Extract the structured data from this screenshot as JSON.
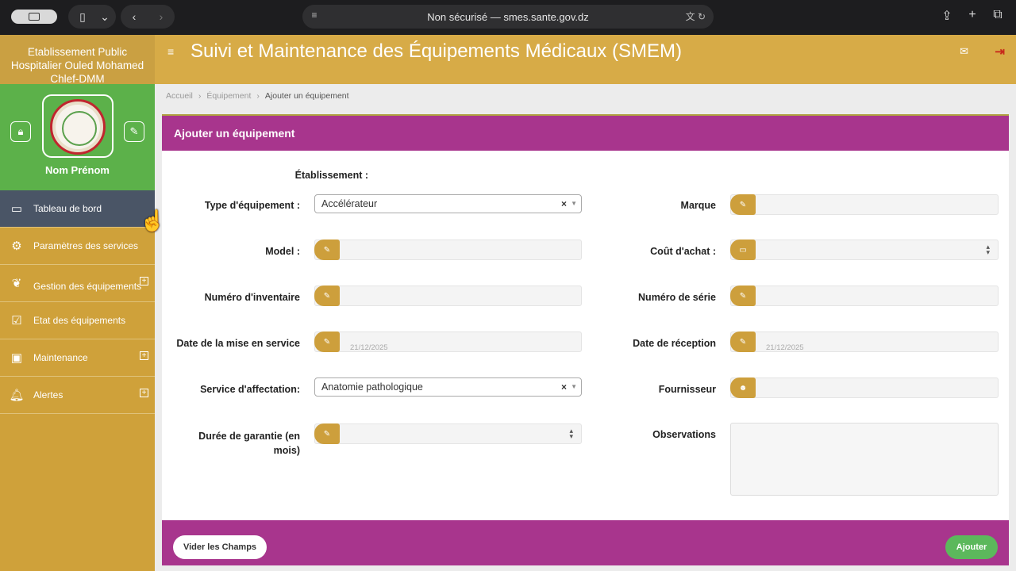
{
  "browser": {
    "address": "Non sécurisé — smes.sante.gov.dz"
  },
  "sidebar": {
    "title": "Etablissement Public Hospitalier Ouled Mohamed Chlef-DMM",
    "profile_name": "Nom Prénom",
    "items": [
      {
        "label": "Tableau de bord",
        "icon": "monitor-icon",
        "expandable": false,
        "active": true
      },
      {
        "label": "Paramètres des services",
        "icon": "gear-icon",
        "expandable": false,
        "active": false
      },
      {
        "label": "Gestion des équipements",
        "icon": "leaf-icon",
        "expandable": true,
        "active": false
      },
      {
        "label": "Etat des équipements",
        "icon": "checkbox-icon",
        "expandable": false,
        "active": false
      },
      {
        "label": "Maintenance",
        "icon": "briefcase-icon",
        "expandable": true,
        "active": false
      },
      {
        "label": "Alertes",
        "icon": "bell-icon",
        "expandable": true,
        "active": false
      }
    ]
  },
  "header": {
    "title": "Suivi et Maintenance des Équipements Médicaux (SMEM)"
  },
  "breadcrumb": {
    "home": "Accueil",
    "section": "Équipement",
    "current": "Ajouter un équipement"
  },
  "form": {
    "title": "Ajouter un équipement",
    "etablissement_label": "Établissement :",
    "type_label": "Type d'équipement :",
    "type_value": "Accélérateur",
    "marque_label": "Marque",
    "model_label": "Model :",
    "cout_label": "Coût d'achat :",
    "inventaire_label": "Numéro d'inventaire",
    "serie_label": "Numéro de série",
    "mise_service_label": "Date de la mise en service",
    "mise_service_value": "21/12/2025",
    "reception_label": "Date de réception",
    "reception_value": "21/12/2025",
    "service_label": "Service d'affectation:",
    "service_value": "Anatomie pathologique",
    "fournisseur_label": "Fournisseur",
    "garantie_label": "Durée de garantie (en mois)",
    "observations_label": "Observations",
    "clear_button": "Vider les Champs",
    "add_button": "Ajouter"
  },
  "colors": {
    "sidebar": "#cfa13a",
    "profile": "#5cb14a",
    "card_header": "#a8358d",
    "addon": "#cd9f3c",
    "add_button": "#5cb85c"
  }
}
